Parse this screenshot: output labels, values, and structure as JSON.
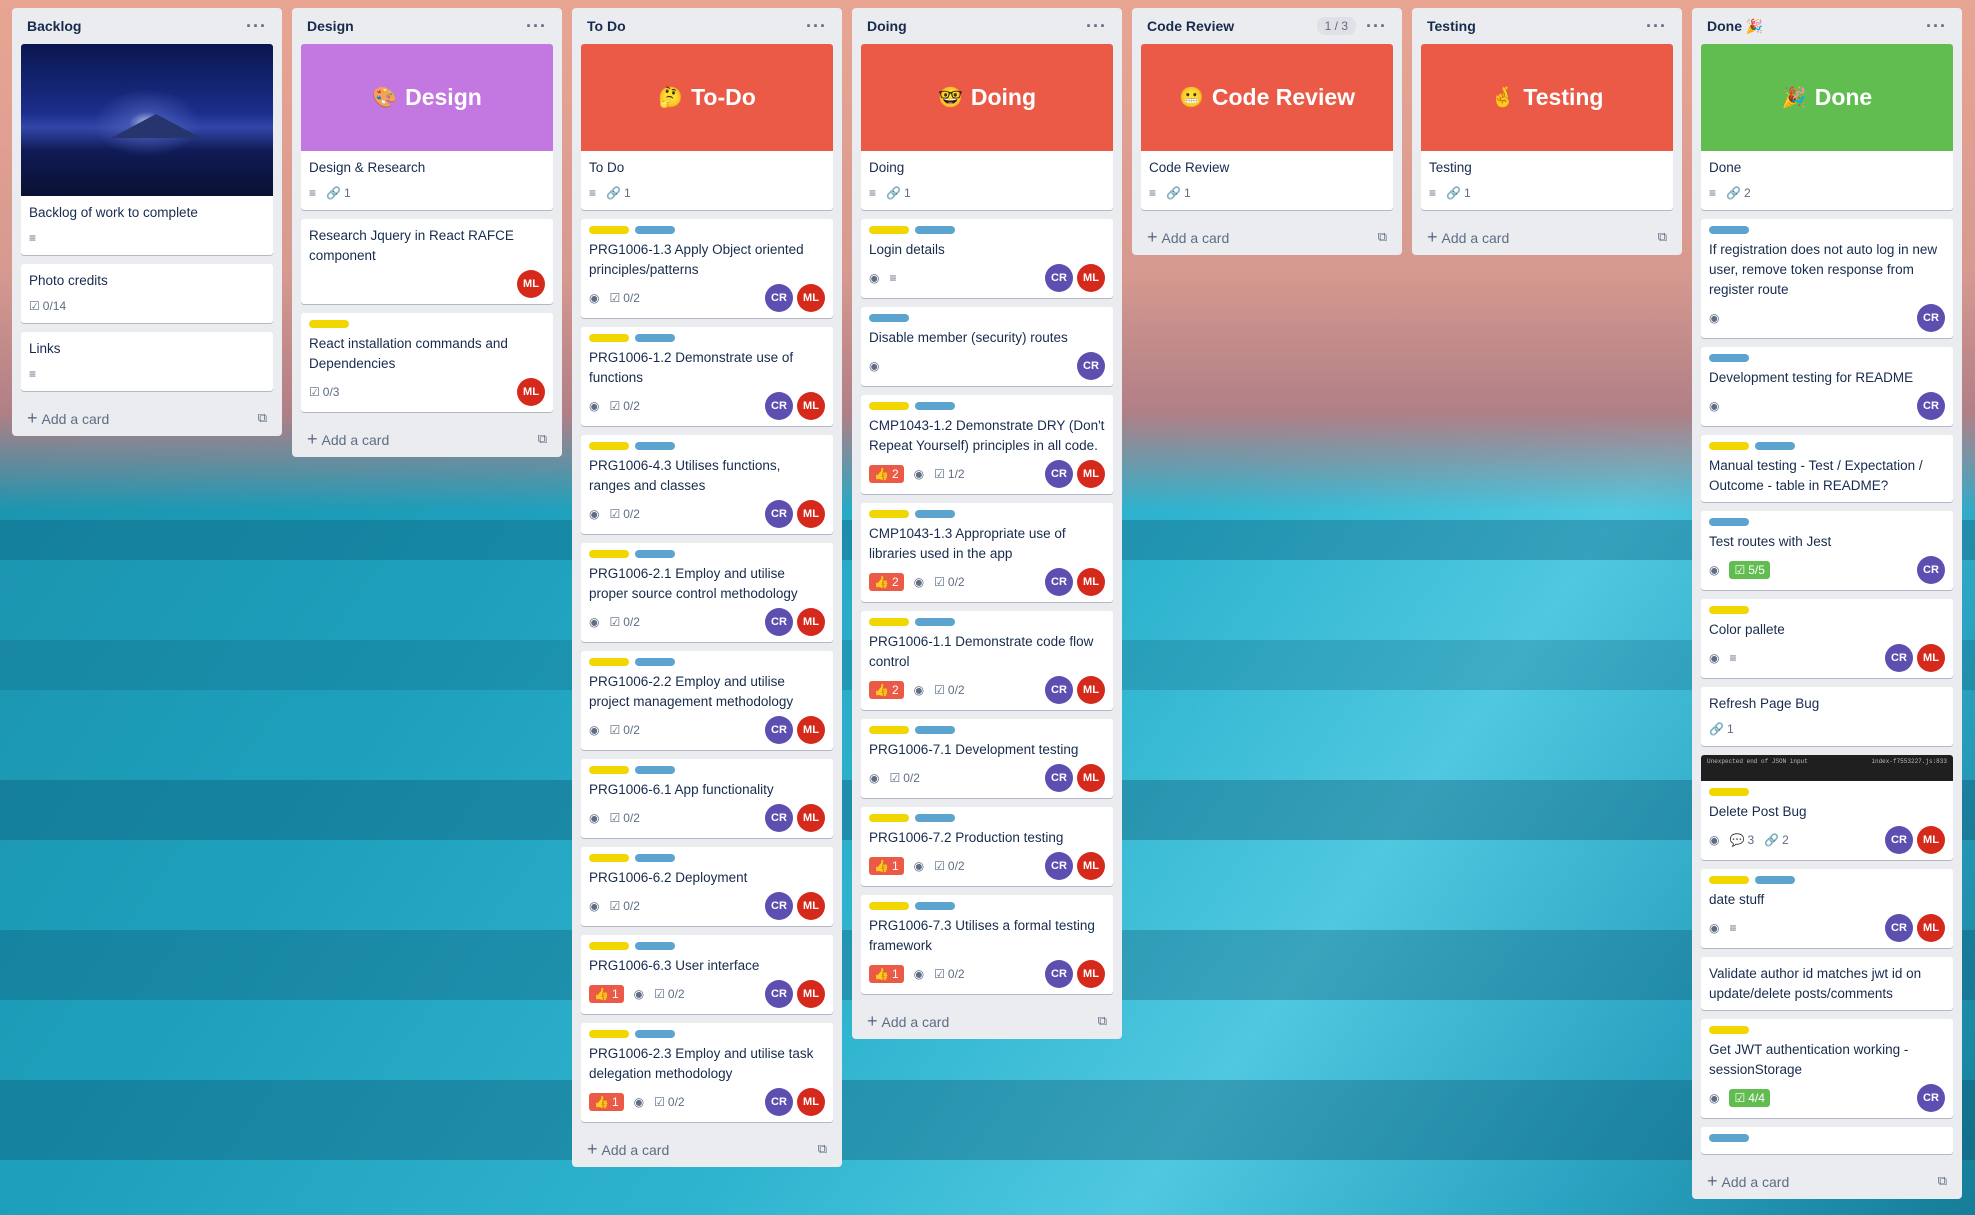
{
  "lists": [
    {
      "name": "Backlog",
      "add_label": "Add a card",
      "cards": [
        {
          "cover_image": true,
          "title": "Backlog of work to complete",
          "badges": [
            {
              "icon": "description-icon",
              "text": ""
            }
          ]
        },
        {
          "title": "Photo credits",
          "badges": [
            {
              "icon": "checklist-icon",
              "text": "0/14"
            }
          ]
        },
        {
          "title": "Links",
          "badges": [
            {
              "icon": "description-icon",
              "text": ""
            }
          ]
        }
      ]
    },
    {
      "name": "Design",
      "add_label": "Add a card",
      "cards": [
        {
          "cover": {
            "text": "Design",
            "emoji": "🎨",
            "color": "#c377e0"
          },
          "title": "Design & Research",
          "badges": [
            {
              "icon": "description-icon",
              "text": ""
            },
            {
              "icon": "attachment-icon",
              "text": "1"
            }
          ]
        },
        {
          "title": "Research Jquery in React RAFCE component",
          "avatars": [
            "ML"
          ]
        },
        {
          "labels": [
            "y"
          ],
          "title": "React installation commands and Dependencies",
          "badges": [
            {
              "icon": "checklist-icon",
              "text": "0/3"
            }
          ],
          "avatars": [
            "ML"
          ]
        }
      ]
    },
    {
      "name": "To Do",
      "add_label": "Add a card",
      "cards": [
        {
          "cover": {
            "text": "To-Do",
            "emoji": "🤔",
            "color": "#eb5a46"
          },
          "title": "To Do",
          "badges": [
            {
              "icon": "description-icon",
              "text": ""
            },
            {
              "icon": "attachment-icon",
              "text": "1"
            }
          ]
        },
        {
          "labels": [
            "y",
            "b"
          ],
          "title": "PRG1006-1.3 Apply Object oriented principles/patterns",
          "badges": [
            {
              "icon": "watch-icon",
              "text": ""
            },
            {
              "icon": "checklist-icon",
              "text": "0/2"
            }
          ],
          "avatars": [
            "CR",
            "ML"
          ]
        },
        {
          "labels": [
            "y",
            "b"
          ],
          "title": "PRG1006-1.2 Demonstrate use of functions",
          "badges": [
            {
              "icon": "watch-icon",
              "text": ""
            },
            {
              "icon": "checklist-icon",
              "text": "0/2"
            }
          ],
          "avatars": [
            "CR",
            "ML"
          ]
        },
        {
          "labels": [
            "y",
            "b"
          ],
          "title": "PRG1006-4.3 Utilises functions, ranges and classes",
          "badges": [
            {
              "icon": "watch-icon",
              "text": ""
            },
            {
              "icon": "checklist-icon",
              "text": "0/2"
            }
          ],
          "avatars": [
            "CR",
            "ML"
          ]
        },
        {
          "labels": [
            "y",
            "b"
          ],
          "title": "PRG1006-2.1 Employ and utilise proper source control methodology",
          "badges": [
            {
              "icon": "watch-icon",
              "text": ""
            },
            {
              "icon": "checklist-icon",
              "text": "0/2"
            }
          ],
          "avatars": [
            "CR",
            "ML"
          ]
        },
        {
          "labels": [
            "y",
            "b"
          ],
          "title": "PRG1006-2.2 Employ and utilise project management methodology",
          "badges": [
            {
              "icon": "watch-icon",
              "text": ""
            },
            {
              "icon": "checklist-icon",
              "text": "0/2"
            }
          ],
          "avatars": [
            "CR",
            "ML"
          ]
        },
        {
          "labels": [
            "y",
            "b"
          ],
          "title": "PRG1006-6.1 App functionality",
          "badges": [
            {
              "icon": "watch-icon",
              "text": ""
            },
            {
              "icon": "checklist-icon",
              "text": "0/2"
            }
          ],
          "avatars": [
            "CR",
            "ML"
          ]
        },
        {
          "labels": [
            "y",
            "b"
          ],
          "title": "PRG1006-6.2 Deployment",
          "badges": [
            {
              "icon": "watch-icon",
              "text": ""
            },
            {
              "icon": "checklist-icon",
              "text": "0/2"
            }
          ],
          "avatars": [
            "CR",
            "ML"
          ]
        },
        {
          "labels": [
            "y",
            "b"
          ],
          "title": "PRG1006-6.3 User interface",
          "badges": [
            {
              "icon": "vote-icon",
              "text": "1",
              "style": "red"
            },
            {
              "icon": "watch-icon",
              "text": ""
            },
            {
              "icon": "checklist-icon",
              "text": "0/2"
            }
          ],
          "avatars": [
            "CR",
            "ML"
          ]
        },
        {
          "labels": [
            "y",
            "b"
          ],
          "title": "PRG1006-2.3 Employ and utilise task delegation methodology",
          "badges": [
            {
              "icon": "vote-icon",
              "text": "1",
              "style": "red"
            },
            {
              "icon": "watch-icon",
              "text": ""
            },
            {
              "icon": "checklist-icon",
              "text": "0/2"
            }
          ],
          "avatars": [
            "CR",
            "ML"
          ]
        }
      ]
    },
    {
      "name": "Doing",
      "add_label": "Add a card",
      "cards": [
        {
          "cover": {
            "text": "Doing",
            "emoji": "🤓",
            "color": "#eb5a46"
          },
          "title": "Doing",
          "badges": [
            {
              "icon": "description-icon",
              "text": ""
            },
            {
              "icon": "attachment-icon",
              "text": "1"
            }
          ]
        },
        {
          "labels": [
            "y",
            "b"
          ],
          "title": "Login details",
          "badges": [
            {
              "icon": "watch-icon",
              "text": ""
            },
            {
              "icon": "description-icon",
              "text": ""
            }
          ],
          "avatars": [
            "CR",
            "ML"
          ]
        },
        {
          "labels": [
            "b"
          ],
          "title": "Disable member (security) routes",
          "badges": [
            {
              "icon": "watch-icon",
              "text": ""
            }
          ],
          "avatars": [
            "CR"
          ]
        },
        {
          "labels": [
            "y",
            "b"
          ],
          "title": "CMP1043-1.2 Demonstrate DRY (Don't Repeat Yourself) principles in all code.",
          "badges": [
            {
              "icon": "vote-icon",
              "text": "2",
              "style": "red"
            },
            {
              "icon": "watch-icon",
              "text": ""
            },
            {
              "icon": "checklist-icon",
              "text": "1/2"
            }
          ],
          "avatars": [
            "CR",
            "ML"
          ]
        },
        {
          "labels": [
            "y",
            "b"
          ],
          "title": "CMP1043-1.3 Appropriate use of libraries used in the app",
          "badges": [
            {
              "icon": "vote-icon",
              "text": "2",
              "style": "red"
            },
            {
              "icon": "watch-icon",
              "text": ""
            },
            {
              "icon": "checklist-icon",
              "text": "0/2"
            }
          ],
          "avatars": [
            "CR",
            "ML"
          ]
        },
        {
          "labels": [
            "y",
            "b"
          ],
          "title": "PRG1006-1.1 Demonstrate code flow control",
          "badges": [
            {
              "icon": "vote-icon",
              "text": "2",
              "style": "red"
            },
            {
              "icon": "watch-icon",
              "text": ""
            },
            {
              "icon": "checklist-icon",
              "text": "0/2"
            }
          ],
          "avatars": [
            "CR",
            "ML"
          ]
        },
        {
          "labels": [
            "y",
            "b"
          ],
          "title": "PRG1006-7.1 Development testing",
          "badges": [
            {
              "icon": "watch-icon",
              "text": ""
            },
            {
              "icon": "checklist-icon",
              "text": "0/2"
            }
          ],
          "avatars": [
            "CR",
            "ML"
          ]
        },
        {
          "labels": [
            "y",
            "b"
          ],
          "title": "PRG1006-7.2 Production testing",
          "badges": [
            {
              "icon": "vote-icon",
              "text": "1",
              "style": "red"
            },
            {
              "icon": "watch-icon",
              "text": ""
            },
            {
              "icon": "checklist-icon",
              "text": "0/2"
            }
          ],
          "avatars": [
            "CR",
            "ML"
          ]
        },
        {
          "labels": [
            "y",
            "b"
          ],
          "title": "PRG1006-7.3 Utilises a formal testing framework",
          "badges": [
            {
              "icon": "vote-icon",
              "text": "1",
              "style": "red"
            },
            {
              "icon": "watch-icon",
              "text": ""
            },
            {
              "icon": "checklist-icon",
              "text": "0/2"
            }
          ],
          "avatars": [
            "CR",
            "ML"
          ]
        }
      ]
    },
    {
      "name": "Code Review",
      "count": "1 / 3",
      "add_label": "Add a card",
      "cards": [
        {
          "cover": {
            "text": "Code Review",
            "emoji": "😬",
            "color": "#eb5a46"
          },
          "title": "Code Review",
          "badges": [
            {
              "icon": "description-icon",
              "text": ""
            },
            {
              "icon": "attachment-icon",
              "text": "1"
            }
          ]
        }
      ]
    },
    {
      "name": "Testing",
      "add_label": "Add a card",
      "cards": [
        {
          "cover": {
            "text": "Testing",
            "emoji": "🤞",
            "color": "#eb5a46"
          },
          "title": "Testing",
          "badges": [
            {
              "icon": "description-icon",
              "text": ""
            },
            {
              "icon": "attachment-icon",
              "text": "1"
            }
          ]
        }
      ]
    },
    {
      "name": "Done 🎉",
      "add_label": "Add a card",
      "cards": [
        {
          "cover": {
            "text": "Done",
            "emoji": "🎉",
            "color": "#61bd4f"
          },
          "title": "Done",
          "badges": [
            {
              "icon": "description-icon",
              "text": ""
            },
            {
              "icon": "attachment-icon",
              "text": "2"
            }
          ]
        },
        {
          "labels": [
            "b"
          ],
          "title": "If registration does not auto log in new user, remove token response from register route",
          "badges": [
            {
              "icon": "watch-icon",
              "text": ""
            }
          ],
          "avatars": [
            "CR"
          ]
        },
        {
          "labels": [
            "b"
          ],
          "title": "Development testing for README",
          "badges": [
            {
              "icon": "watch-icon",
              "text": ""
            }
          ],
          "avatars": [
            "CR"
          ]
        },
        {
          "labels": [
            "y",
            "b"
          ],
          "title": "Manual testing - Test / Expectation / Outcome - table in README?"
        },
        {
          "labels": [
            "b"
          ],
          "title": "Test routes with Jest",
          "badges": [
            {
              "icon": "watch-icon",
              "text": ""
            },
            {
              "icon": "checklist-icon",
              "text": "5/5",
              "style": "green"
            }
          ],
          "avatars": [
            "CR"
          ]
        },
        {
          "labels": [
            "y"
          ],
          "title": "Color pallete",
          "badges": [
            {
              "icon": "watch-icon",
              "text": ""
            },
            {
              "icon": "description-icon",
              "text": ""
            }
          ],
          "avatars": [
            "CR",
            "ML"
          ]
        },
        {
          "title": "Refresh Page Bug",
          "badges": [
            {
              "icon": "attachment-icon",
              "text": "1"
            }
          ]
        },
        {
          "cover_strip": {
            "left": "Unexpected end of JSON input",
            "right": "index-f7553227.js:833"
          },
          "labels": [
            "y"
          ],
          "title": "Delete Post Bug",
          "badges": [
            {
              "icon": "watch-icon",
              "text": ""
            },
            {
              "icon": "comment-icon",
              "text": "3"
            },
            {
              "icon": "attachment-icon",
              "text": "2"
            }
          ],
          "avatars": [
            "CR",
            "ML"
          ]
        },
        {
          "labels": [
            "y",
            "b"
          ],
          "title": "date stuff",
          "badges": [
            {
              "icon": "watch-icon",
              "text": ""
            },
            {
              "icon": "description-icon",
              "text": ""
            }
          ],
          "avatars": [
            "CR",
            "ML"
          ]
        },
        {
          "title": "Validate author id matches jwt id on update/delete posts/comments"
        },
        {
          "labels": [
            "y"
          ],
          "title": "Get JWT authentication working - sessionStorage",
          "badges": [
            {
              "icon": "watch-icon",
              "text": ""
            },
            {
              "icon": "checklist-icon",
              "text": "4/4",
              "style": "green"
            }
          ],
          "avatars": [
            "CR"
          ]
        },
        {
          "labels": [
            "b"
          ],
          "title": ""
        }
      ]
    }
  ],
  "icons": {
    "description-icon": "≡",
    "attachment-icon": "🔗",
    "checklist-icon": "☑",
    "watch-icon": "◉",
    "vote-icon": "👍",
    "comment-icon": "💬"
  },
  "colors": {
    "cr": "#5c4fb0",
    "ml": "#d5291c",
    "label_yellow": "#f2d600",
    "label_blue": "#5ba4cf"
  }
}
